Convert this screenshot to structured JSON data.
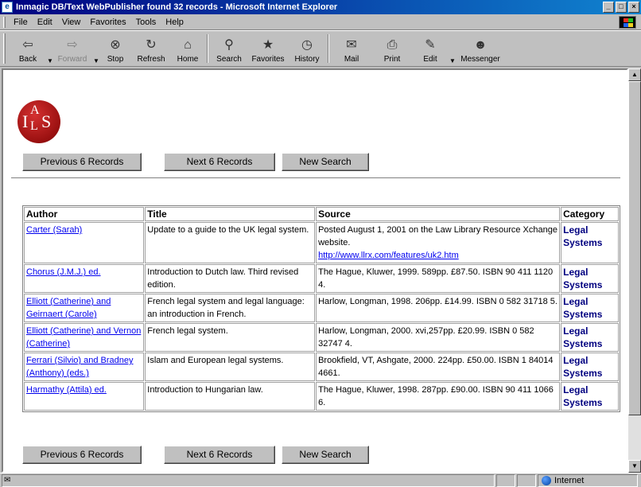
{
  "window": {
    "title": "Inmagic DB/Text WebPublisher found 32 records - Microsoft Internet Explorer",
    "app_icon": "ie-icon",
    "controls": [
      "_",
      "□",
      "×"
    ]
  },
  "menu": [
    "File",
    "Edit",
    "View",
    "Favorites",
    "Tools",
    "Help"
  ],
  "toolbar": {
    "back": "Back",
    "forward": "Forward",
    "stop": "Stop",
    "refresh": "Refresh",
    "home": "Home",
    "search": "Search",
    "favorites": "Favorites",
    "history": "History",
    "mail": "Mail",
    "print": "Print",
    "edit": "Edit",
    "messenger": "Messenger"
  },
  "logo": {
    "letters": [
      "I",
      "A",
      "L",
      "S"
    ]
  },
  "nav": {
    "prev": "Previous 6 Records",
    "next": "Next 6 Records",
    "new_search": "New Search"
  },
  "table": {
    "headers": [
      "Author",
      "Title",
      "Source",
      "Category"
    ],
    "rows": [
      {
        "author": "Carter (Sarah)",
        "title": "Update to a guide to the UK legal system.",
        "source": "Posted August 1, 2001 on the Law Library Resource Xchange website.",
        "source_link": "http://www.llrx.com/features/uk2.htm",
        "category": "Legal Systems"
      },
      {
        "author": "Chorus (J.M.J.) ed.",
        "title": "Introduction to Dutch law. Third revised edition.",
        "source": "The Hague, Kluwer, 1999. 589pp. £87.50. ISBN 90 411 1120 4.",
        "source_link": "",
        "category": "Legal Systems"
      },
      {
        "author": "Elliott (Catherine) and Geirnaert (Carole)",
        "title": "French legal system and legal language: an introduction in French.",
        "source": "Harlow, Longman, 1998. 206pp. £14.99. ISBN 0 582 31718 5.",
        "source_link": "",
        "category": "Legal Systems"
      },
      {
        "author": "Elliott (Catherine) and Vernon (Catherine)",
        "title": "French legal system.",
        "source": "Harlow, Longman, 2000. xvi,257pp. £20.99. ISBN 0 582 32747 4.",
        "source_link": "",
        "category": "Legal Systems"
      },
      {
        "author": "Ferrari (Silvio) and Bradney (Anthony) (eds.)",
        "title": "Islam and European legal systems.",
        "source": "Brookfield, VT, Ashgate, 2000. 224pp. £50.00. ISBN 1 84014 4661.",
        "source_link": "",
        "category": "Legal Systems"
      },
      {
        "author": "Harmathy (Attila) ed.",
        "title": "Introduction to Hungarian law.",
        "source": "The Hague, Kluwer, 1998. 287pp. £90.00. ISBN 90 411 1066 6.",
        "source_link": "",
        "category": "Legal Systems"
      }
    ]
  },
  "status": {
    "zone": "Internet"
  }
}
